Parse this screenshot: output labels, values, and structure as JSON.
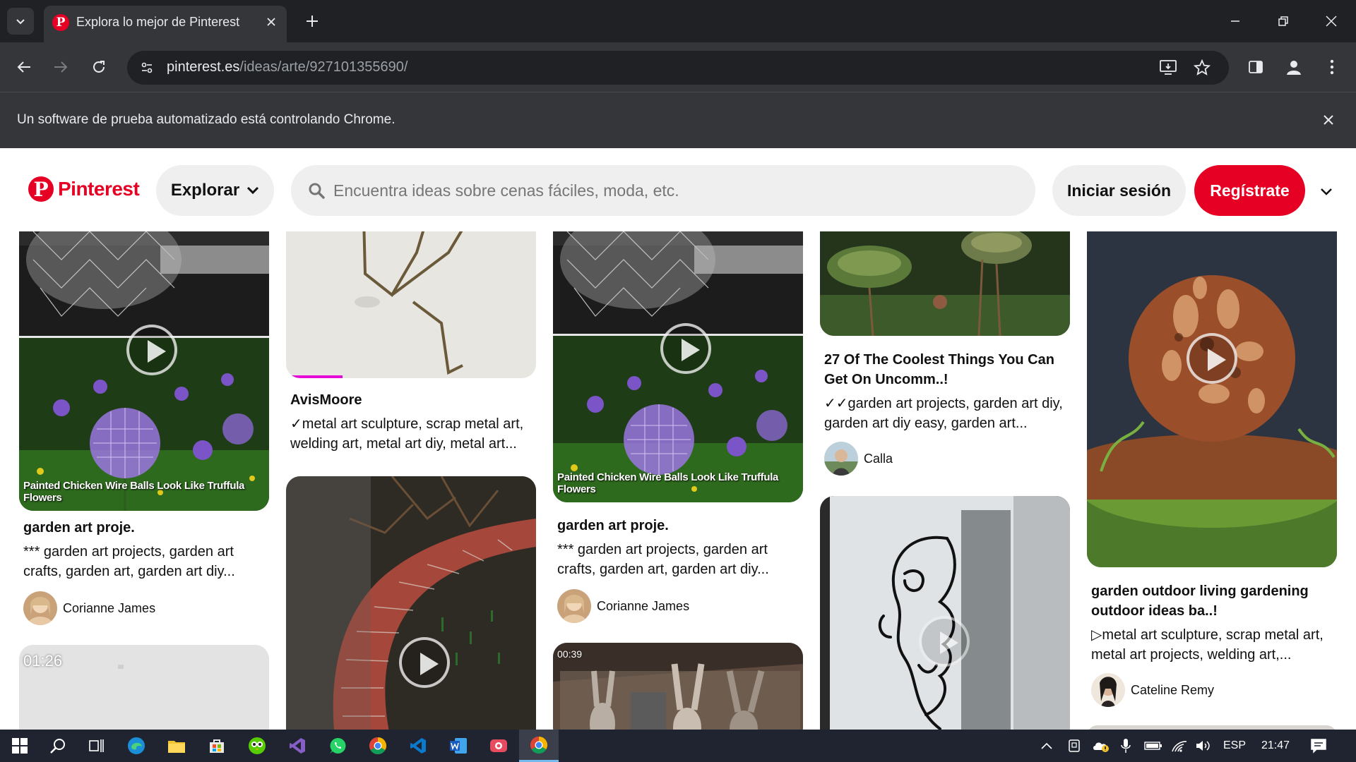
{
  "browser": {
    "tab_title": "Explora lo mejor de Pinterest",
    "url_host": "pinterest.es",
    "url_path": "/ideas/arte/927101355690/",
    "infobar_text": "Un software de prueba automatizado está controlando Chrome."
  },
  "header": {
    "logo_text": "Pinterest",
    "explore_label": "Explorar",
    "search_placeholder": "Encuentra ideas sobre cenas fáciles, moda, etc.",
    "login_label": "Iniciar sesión",
    "signup_label": "Regístrate"
  },
  "pins": {
    "col1": {
      "overlay": "Painted Chicken Wire Balls Look Like Truffula Flowers",
      "title": "garden art proje.",
      "description": "*** garden art projects, garden art crafts, garden art, garden art diy...",
      "author": "Corianne James",
      "next_duration": "01:26"
    },
    "col2": {
      "title": "AvisMoore",
      "description": "✓metal art sculpture, scrap metal art, welding art, metal art diy, metal art..."
    },
    "col3": {
      "overlay": "Painted Chicken Wire Balls Look Like Truffula Flowers",
      "title": "garden art proje.",
      "description": "*** garden art projects, garden art crafts, garden art, garden art diy...",
      "author": "Corianne James",
      "next_duration": "00:39"
    },
    "col4": {
      "title": "27 Of The Coolest Things You Can Get On Uncomm..!",
      "description": "✓✓garden art projects, garden art diy, garden art diy easy, garden art...",
      "author": "Calla"
    },
    "col5": {
      "title": "garden outdoor living gardening outdoor ideas ba..!",
      "description": "▷metal art sculpture, scrap metal art, metal art projects, welding art,...",
      "author": "Cateline Remy"
    }
  },
  "taskbar": {
    "language": "ESP",
    "time": "21:47"
  },
  "colors": {
    "pinterest_red": "#e60023",
    "chrome_dark": "#202124",
    "chrome_toolbar": "#35363a"
  }
}
